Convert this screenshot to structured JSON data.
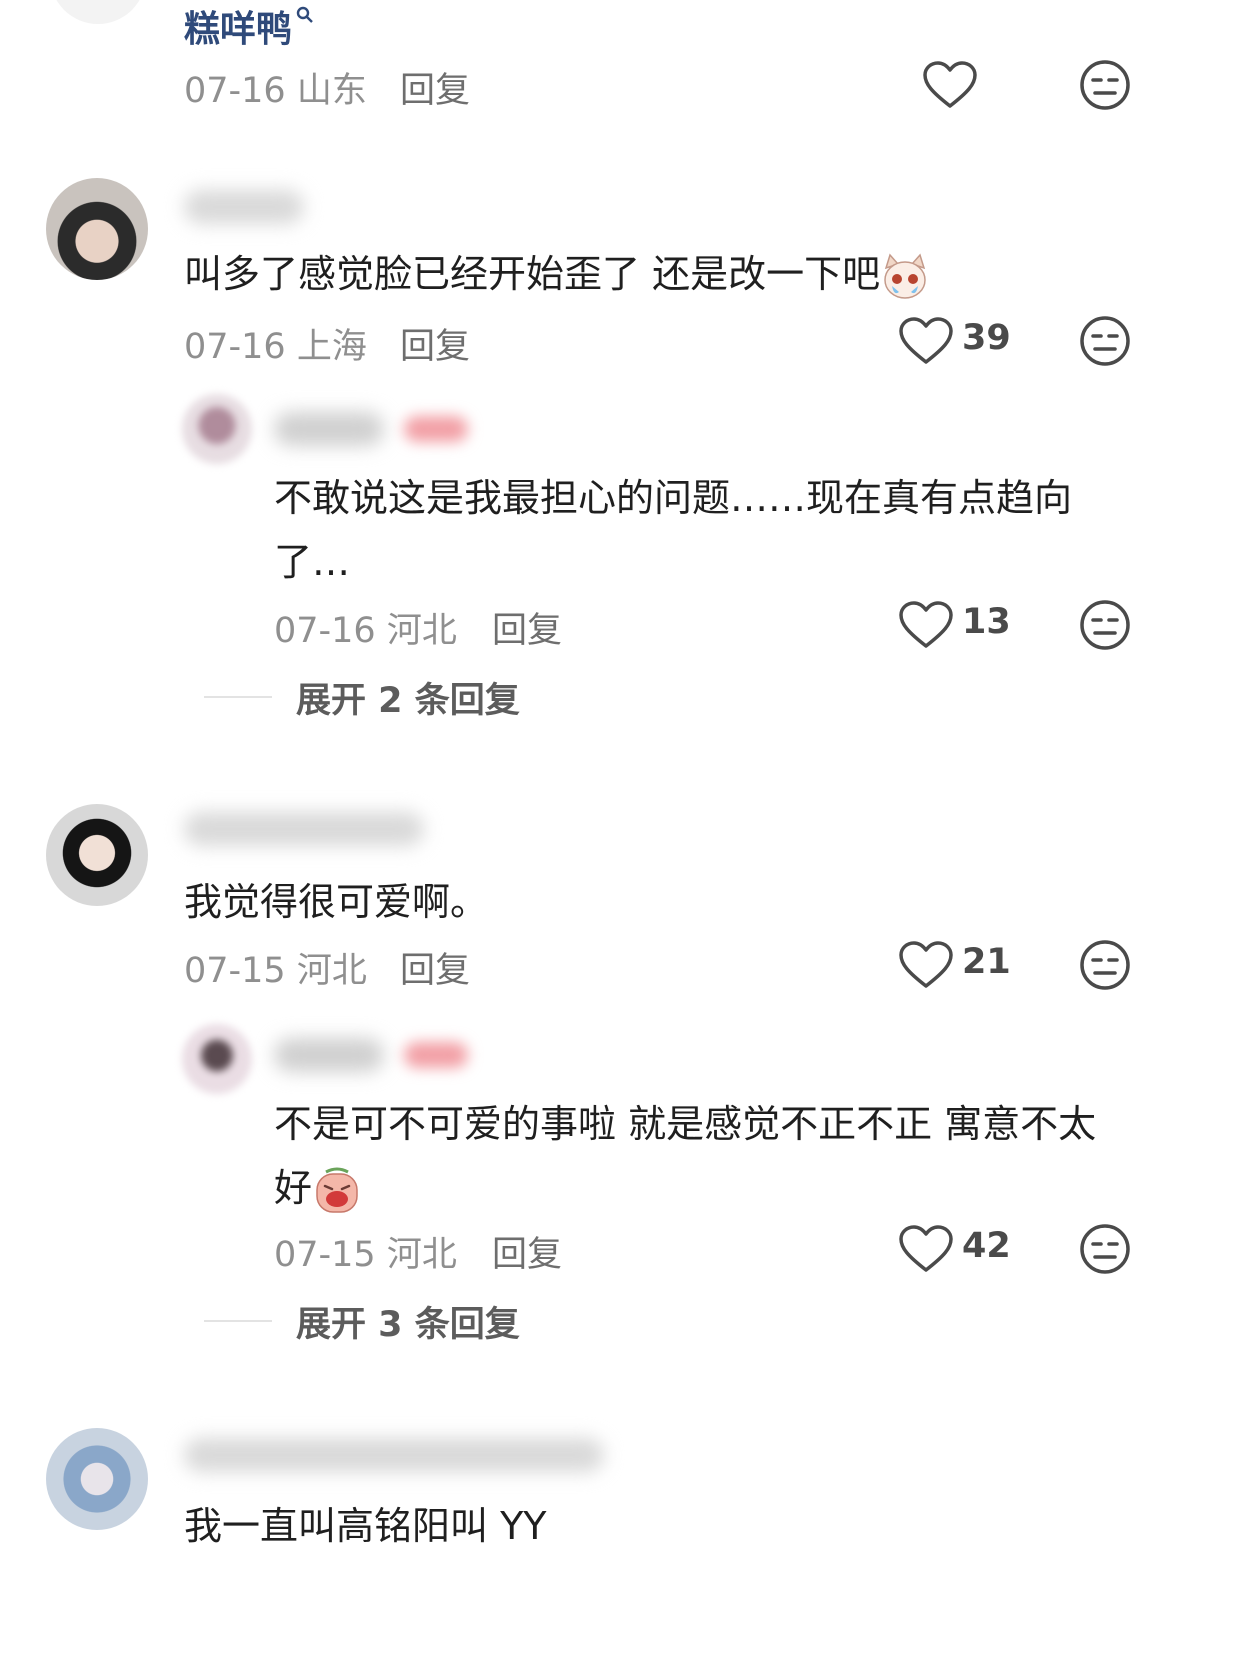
{
  "top_reply": {
    "username": "糕咩鸭",
    "date": "07-16",
    "location": "山东",
    "reply_label": "回复"
  },
  "comments": [
    {
      "text": "叫多了感觉脸已经开始歪了 还是改一下吧",
      "date": "07-16",
      "location": "上海",
      "reply_label": "回复",
      "likes": "39"
    },
    {
      "text": "不敢说这是我最担心的问题……现在真有点趋向了…",
      "date": "07-16",
      "location": "河北",
      "reply_label": "回复",
      "likes": "13",
      "expand": "展开 2 条回复"
    },
    {
      "text": "我觉得很可爱啊。",
      "date": "07-15",
      "location": "河北",
      "reply_label": "回复",
      "likes": "21"
    },
    {
      "text": "不是可不可爱的事啦 就是感觉不正不正 寓意不太好",
      "date": "07-15",
      "location": "河北",
      "reply_label": "回复",
      "likes": "42",
      "expand": "展开 3 条回复"
    },
    {
      "text": "我一直叫高铭阳叫 YY"
    }
  ],
  "colors": {
    "username": "#2f4a7a",
    "meta": "#8f8f8f",
    "icon": "#4a4a4a"
  }
}
